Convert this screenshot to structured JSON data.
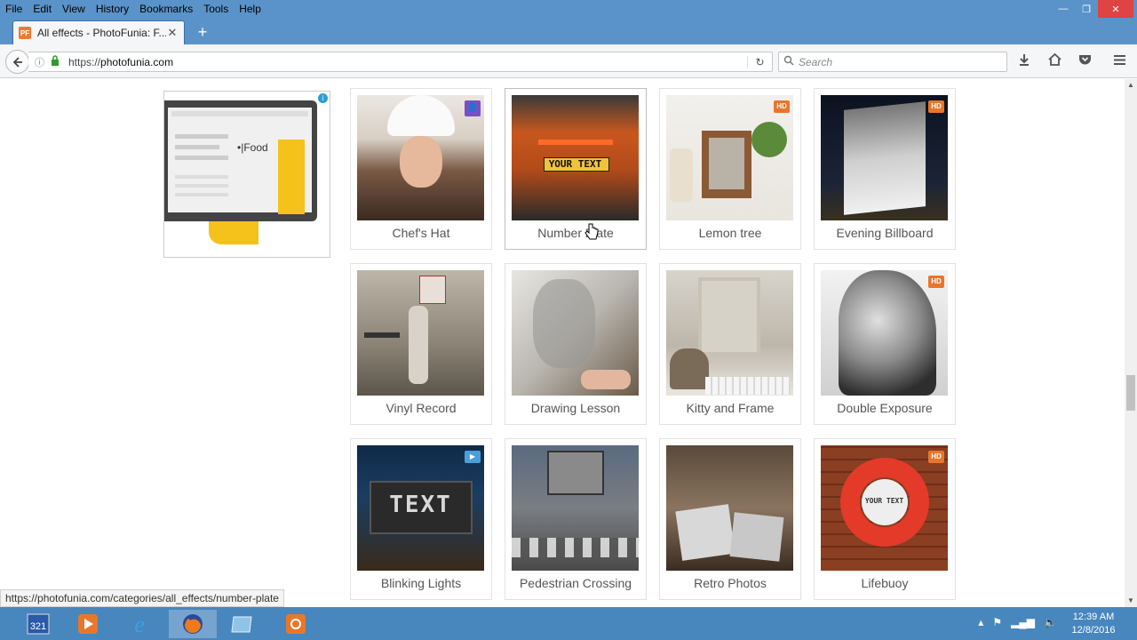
{
  "menu": {
    "items": [
      "File",
      "Edit",
      "View",
      "History",
      "Bookmarks",
      "Tools",
      "Help"
    ]
  },
  "window": {
    "minimize": "—",
    "restore": "❐",
    "close": "✕"
  },
  "tab": {
    "title": "All effects - PhotoFunia: F...",
    "favicon": "PF",
    "close": "✕",
    "new_tab": "+"
  },
  "nav": {
    "url_scheme": "https://",
    "url_host": "photofunia.com",
    "search_placeholder": "Search"
  },
  "ad": {
    "food_text": "Food"
  },
  "effects": [
    {
      "label": "Chef's Hat",
      "badge": "user"
    },
    {
      "label": "Number Plate",
      "badge": "",
      "plate_text": "YOUR TEXT"
    },
    {
      "label": "Lemon tree",
      "badge": "HD"
    },
    {
      "label": "Evening Billboard",
      "badge": "HD"
    },
    {
      "label": "Vinyl Record",
      "badge": ""
    },
    {
      "label": "Drawing Lesson",
      "badge": ""
    },
    {
      "label": "Kitty and Frame",
      "badge": ""
    },
    {
      "label": "Double Exposure",
      "badge": "HD"
    },
    {
      "label": "Blinking Lights",
      "badge": "video",
      "sign_text": "TEXT"
    },
    {
      "label": "Pedestrian Crossing",
      "badge": ""
    },
    {
      "label": "Retro Photos",
      "badge": ""
    },
    {
      "label": "Lifebuoy",
      "badge": "HD",
      "ring_text": "YOUR TEXT"
    }
  ],
  "status": {
    "link": "https://photofunia.com/categories/all_effects/number-plate"
  },
  "taskbar": {
    "clock_time": "12:39 AM",
    "clock_date": "12/8/2016"
  },
  "colors": {
    "titlebar": "#5a93c9",
    "taskbar": "#4886be",
    "hd_badge": "#e8762b",
    "label_text": "#555555"
  }
}
